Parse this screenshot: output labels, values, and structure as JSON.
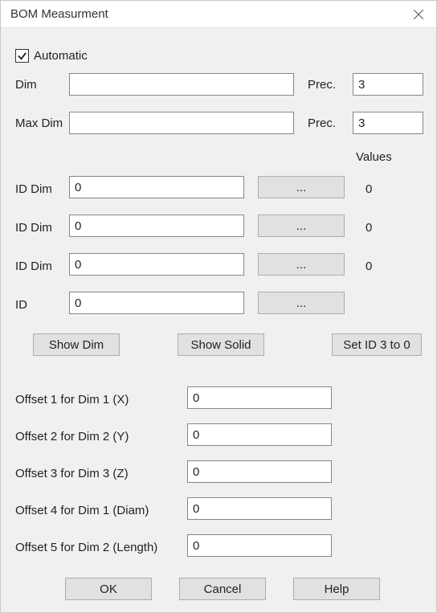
{
  "title": "BOM Measurment",
  "automatic": {
    "label": "Automatic",
    "checked": true
  },
  "dim": {
    "label": "Dim",
    "value": "",
    "prec_label": "Prec.",
    "prec_value": "3"
  },
  "max_dim": {
    "label": "Max Dim",
    "value": "",
    "prec_label": "Prec.",
    "prec_value": "3"
  },
  "values_header": "Values",
  "id_rows": [
    {
      "label": "ID Dim",
      "value": "0",
      "browse": "...",
      "result": "0"
    },
    {
      "label": "ID Dim",
      "value": "0",
      "browse": "...",
      "result": "0"
    },
    {
      "label": "ID Dim",
      "value": "0",
      "browse": "...",
      "result": "0"
    },
    {
      "label": "ID",
      "value": "0",
      "browse": "...",
      "result": ""
    }
  ],
  "buttons_mid": {
    "show_dim": "Show Dim",
    "show_solid": "Show Solid",
    "set_id": "Set ID 3 to 0"
  },
  "offsets": [
    {
      "label": "Offset 1 for Dim 1 (X)",
      "value": "0"
    },
    {
      "label": "Offset 2 for Dim 2 (Y)",
      "value": "0"
    },
    {
      "label": "Offset 3 for Dim 3 (Z)",
      "value": "0"
    },
    {
      "label": "Offset 4 for Dim 1 (Diam)",
      "value": "0"
    },
    {
      "label": "Offset 5 for Dim 2 (Length)",
      "value": "0"
    }
  ],
  "footer": {
    "ok": "OK",
    "cancel": "Cancel",
    "help": "Help"
  }
}
